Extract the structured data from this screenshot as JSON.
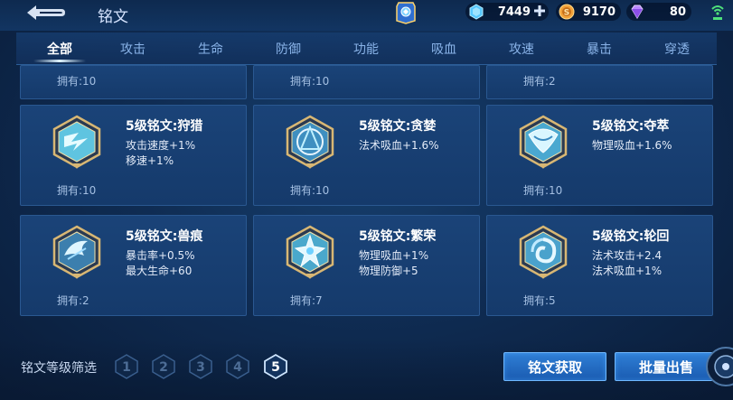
{
  "header": {
    "title": "铭文",
    "currencies": {
      "crystal": "7449",
      "gold": "9170",
      "diamond": "80"
    }
  },
  "tabs": [
    {
      "label": "全部",
      "active": true
    },
    {
      "label": "攻击"
    },
    {
      "label": "生命"
    },
    {
      "label": "防御"
    },
    {
      "label": "功能"
    },
    {
      "label": "吸血"
    },
    {
      "label": "攻速"
    },
    {
      "label": "暴击"
    },
    {
      "label": "穿透"
    }
  ],
  "partial_cards": [
    {
      "owned": "拥有:10"
    },
    {
      "owned": "拥有:10"
    },
    {
      "owned": "拥有:2"
    }
  ],
  "cards": [
    {
      "name": "5级铭文:狩猎",
      "attrs": [
        "攻击速度+1%",
        "移速+1%"
      ],
      "owned": "拥有:10",
      "icon": "hunt-rune-icon"
    },
    {
      "name": "5级铭文:贪婪",
      "attrs": [
        "法术吸血+1.6%",
        ""
      ],
      "owned": "拥有:10",
      "icon": "greed-rune-icon"
    },
    {
      "name": "5级铭文:夺萃",
      "attrs": [
        "物理吸血+1.6%",
        ""
      ],
      "owned": "拥有:10",
      "icon": "seize-rune-icon"
    },
    {
      "name": "5级铭文:兽痕",
      "attrs": [
        "暴击率+0.5%",
        "最大生命+60"
      ],
      "owned": "拥有:2",
      "icon": "beast-mark-rune-icon"
    },
    {
      "name": "5级铭文:繁荣",
      "attrs": [
        "物理吸血+1%",
        "物理防御+5"
      ],
      "owned": "拥有:7",
      "icon": "prosperity-rune-icon"
    },
    {
      "name": "5级铭文:轮回",
      "attrs": [
        "法术攻击+2.4",
        "法术吸血+1%"
      ],
      "owned": "拥有:5",
      "icon": "reincarnation-rune-icon"
    }
  ],
  "filter": {
    "label": "铭文等级筛选",
    "levels": [
      "1",
      "2",
      "3",
      "4",
      "5"
    ],
    "selected": "5"
  },
  "buttons": {
    "acquire": "铭文获取",
    "bulk_sell": "批量出售"
  }
}
